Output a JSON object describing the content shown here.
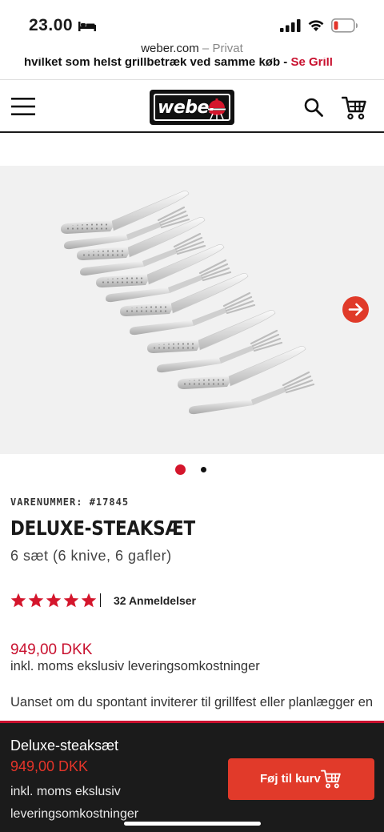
{
  "status_bar": {
    "time": "23.00",
    "icons": [
      "bed-icon",
      "signal-icon",
      "wifi-icon",
      "battery-low-icon"
    ]
  },
  "browser": {
    "domain": "weber.com",
    "separator": " – ",
    "mode": "Privat"
  },
  "promo": {
    "text": "hvilket som helst grillbetræk ved samme køb - ",
    "link": "Se Grill"
  },
  "header": {
    "logo_text": "weber",
    "icons": [
      "menu-icon",
      "search-icon",
      "cart-icon"
    ]
  },
  "gallery": {
    "slide_count": 2,
    "active_slide": 1,
    "next_icon": "arrow-right-icon"
  },
  "product": {
    "sku_label": "VARENUMMER: #17845",
    "title": "DELUXE-STEAKSÆT",
    "subtitle": "6 sæt (6 knive, 6 gafler)",
    "rating_stars": 5,
    "reviews_label": "32 Anmeldelser",
    "price": "949,00 DKK",
    "price_note": "inkl. moms ekslusiv leveringsomkostninger",
    "description_start": "Uanset om du spontant inviterer til grillfest eller planlægger en"
  },
  "sticky_bar": {
    "name": "Deluxe-steaksæt",
    "price": "949,00 DKK",
    "note": "inkl. moms ekslusiv leveringsomkostninger",
    "add_to_cart_label": "Føj til kurv"
  },
  "colors": {
    "brand_red": "#c8102e",
    "button_red": "#e13a2a",
    "sticky_bg": "#1b1b1b",
    "gallery_bg": "#f1f1f1"
  }
}
